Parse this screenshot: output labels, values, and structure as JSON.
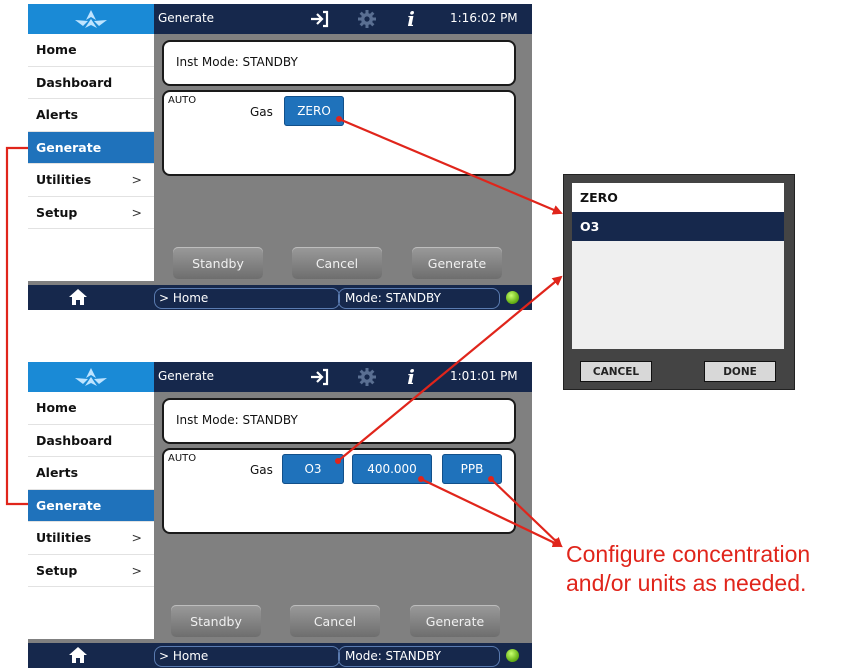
{
  "screens": [
    {
      "title": "Generate",
      "time": "1:16:02 PM",
      "nav": [
        {
          "label": "Home",
          "chevron": ""
        },
        {
          "label": "Dashboard",
          "chevron": ""
        },
        {
          "label": "Alerts",
          "chevron": ""
        },
        {
          "label": "Generate",
          "chevron": ""
        },
        {
          "label": "Utilities",
          "chevron": ">"
        },
        {
          "label": "Setup",
          "chevron": ">"
        }
      ],
      "inst_mode": "Inst Mode:  STANDBY",
      "auto": "AUTO",
      "gas_label": "Gas",
      "gas_value": "ZERO",
      "buttons": {
        "standby": "Standby",
        "cancel": "Cancel",
        "generate": "Generate"
      },
      "breadcrumb": "> Home",
      "mode": "Mode: STANDBY"
    },
    {
      "title": "Generate",
      "time": "1:01:01 PM",
      "nav": [
        {
          "label": "Home",
          "chevron": ""
        },
        {
          "label": "Dashboard",
          "chevron": ""
        },
        {
          "label": "Alerts",
          "chevron": ""
        },
        {
          "label": "Generate",
          "chevron": ""
        },
        {
          "label": "Utilities",
          "chevron": ">"
        },
        {
          "label": "Setup",
          "chevron": ">"
        }
      ],
      "inst_mode": "Inst Mode:  STANDBY",
      "auto": "AUTO",
      "gas_label": "Gas",
      "gas_value": "O3",
      "concentration": "400.000",
      "units": "PPB",
      "buttons": {
        "standby": "Standby",
        "cancel": "Cancel",
        "generate": "Generate"
      },
      "breadcrumb": "> Home",
      "mode": "Mode: STANDBY"
    }
  ],
  "dialog": {
    "options": [
      "ZERO",
      "O3"
    ],
    "selected": "O3",
    "cancel": "CANCEL",
    "done": "DONE"
  },
  "callout": {
    "line1": "Configure concentration",
    "line2": "and/or units as needed."
  },
  "colors": {
    "navy": "#16284c",
    "accent_blue": "#1f72bb",
    "panel_gray": "#808080",
    "arrow_red": "#e0251b",
    "status_led": "#6bb61a"
  },
  "icons": [
    "teledyne-logo-icon",
    "sign-out-icon",
    "gear-icon",
    "info-icon",
    "home-icon",
    "status-led-icon"
  ]
}
